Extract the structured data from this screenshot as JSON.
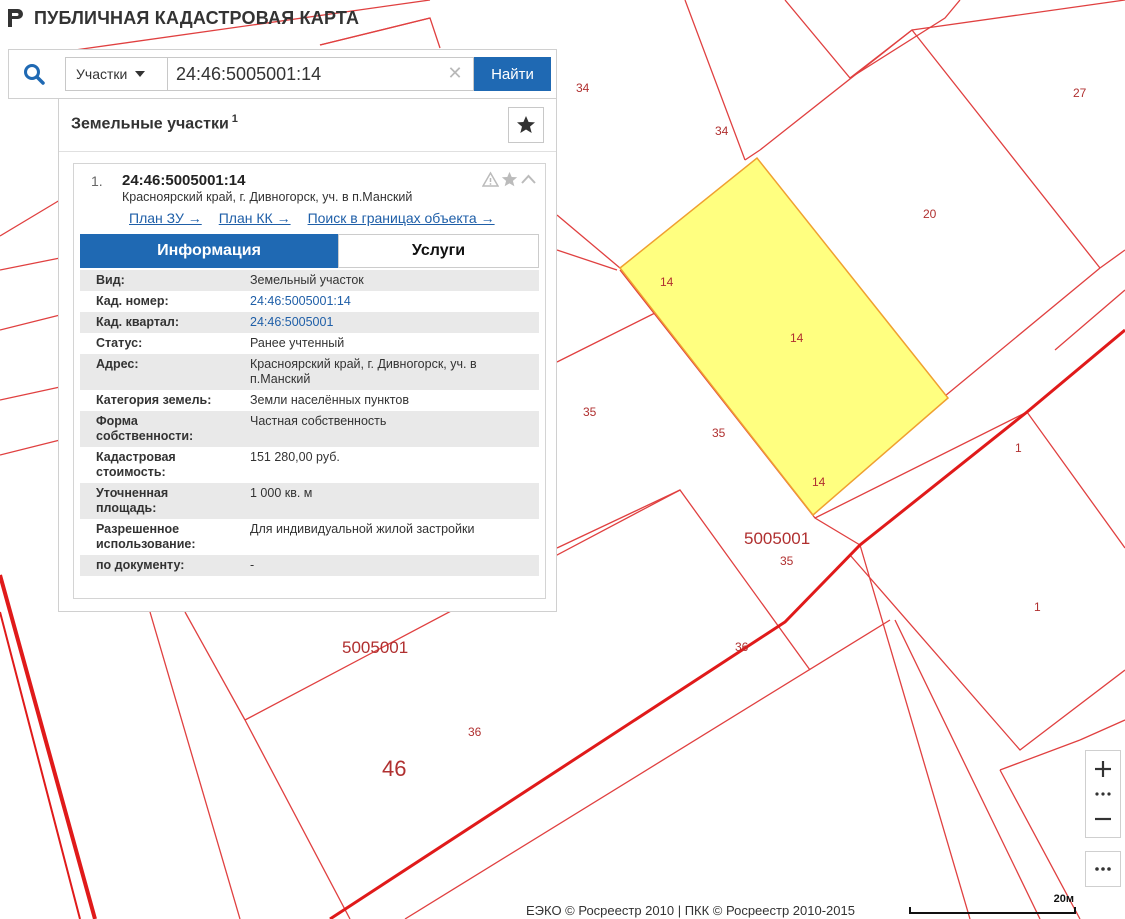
{
  "app": {
    "title": "ПУБЛИЧНАЯ КАДАСТРОВАЯ КАРТА"
  },
  "search": {
    "type_label": "Участки",
    "query": "24:46:5005001:14",
    "button_label": "Найти"
  },
  "panel": {
    "title": "Земельные участки",
    "count": "1"
  },
  "result": {
    "index": "1.",
    "cad_number": "24:46:5005001:14",
    "address": "Красноярский край, г. Дивногорск, уч. в п.Манский",
    "links": [
      "План ЗУ →",
      "План КК →",
      "Поиск в границах объекта →"
    ]
  },
  "tabs": {
    "info": "Информация",
    "services": "Услуги"
  },
  "info_rows": [
    {
      "key": "Вид:",
      "value": "Земельный участок"
    },
    {
      "key": "Кад. номер:",
      "value": "24:46:5005001:14"
    },
    {
      "key": "Кад. квартал:",
      "value": "24:46:5005001"
    },
    {
      "key": "Статус:",
      "value": "Ранее учтенный"
    },
    {
      "key": "Адрес:",
      "value": "Красноярский край, г. Дивногорск, уч. в п.Манский"
    },
    {
      "key": "Категория земель:",
      "value": "Земли населённых пунктов"
    },
    {
      "key": "Форма собственности:",
      "value": "Частная собственность"
    },
    {
      "key": "Кадастровая стоимость:",
      "value": "151 280,00 руб."
    },
    {
      "key": "Уточненная площадь:",
      "value": "1 000 кв. м"
    },
    {
      "key": "Разрешенное использование:",
      "value": "Для индивидуальной жилой застройки"
    },
    {
      "key": "по документу:",
      "value": "-"
    }
  ],
  "map": {
    "labels": {
      "p34a": "34",
      "p34b": "34",
      "p27": "27",
      "p20": "20",
      "p14a": "14",
      "p14b": "14",
      "p14c": "14",
      "p35a": "35",
      "p35b": "35",
      "p35c": "35",
      "q5005001a": "5005001",
      "q5005001b": "5005001",
      "p1a": "1",
      "p1b": "1",
      "p36a": "36",
      "p36b": "36",
      "d46": "46"
    },
    "highlight_color": "#ffff80",
    "boundary_color": "#e02020"
  },
  "footer": {
    "copyright": "ЕЭКО © Росреестр 2010 | ПКК © Росреестр 2010-2015",
    "scale": "20м"
  }
}
